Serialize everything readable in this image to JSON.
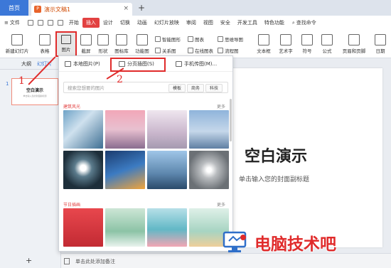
{
  "titlebar": {
    "home_tab": "首页",
    "doc_tab": "演示文稿1",
    "doc_icon": "P",
    "close": "×",
    "new_tab": "+"
  },
  "menubar": {
    "file": "文件",
    "items": [
      "开始",
      "插入",
      "设计",
      "切换",
      "动画",
      "幻灯片放映",
      "审阅",
      "视图",
      "安全",
      "开发工具",
      "特色功能"
    ],
    "active_index": 1,
    "search": "查找命令"
  },
  "ribbon": {
    "new_slide": "新建幻灯片",
    "table": "表格",
    "picture": "图片",
    "screenshot": "截屏",
    "shape": "形状",
    "icon_lib": "图标库",
    "function_chart": "功能图",
    "smart_graphic": "智能图形",
    "chart": "图表",
    "relation": "关系图",
    "online_chart": "在线图表",
    "mind_map": "思维导图",
    "flowchart": "流程图",
    "textbox": "文本框",
    "art_text": "艺术字",
    "symbol": "符号",
    "formula": "公式",
    "header_footer": "页眉和页脚",
    "date": "日期"
  },
  "leftpane": {
    "tab_outline": "大纲",
    "tab_slides": "幻灯片",
    "slide_number": "1",
    "thumb_title": "空白演示",
    "thumb_sub": "单击输入您的封面副标题",
    "add": "+"
  },
  "slide": {
    "title": "空白演示",
    "subtitle": "单击输入您的封面副标题"
  },
  "statusbar": {
    "notes": "单击此处添加备注"
  },
  "dropdown": {
    "tabs": [
      "本地图片(P)",
      "分页插图(S)",
      "手机传图(M)..."
    ],
    "search_placeholder": "搜索您想要的图片",
    "keywords": [
      "模板",
      "商务",
      "科技"
    ],
    "section1": "建筑风光",
    "section2": "节日插画",
    "more": "更多"
  },
  "annotations": {
    "step1": "1",
    "step2": "2"
  },
  "watermark": {
    "text": "电脑技术吧"
  },
  "colors": {
    "accent_red": "#e02b2b",
    "wps_blue": "#3c78d8",
    "active_tab": "#e24141"
  }
}
